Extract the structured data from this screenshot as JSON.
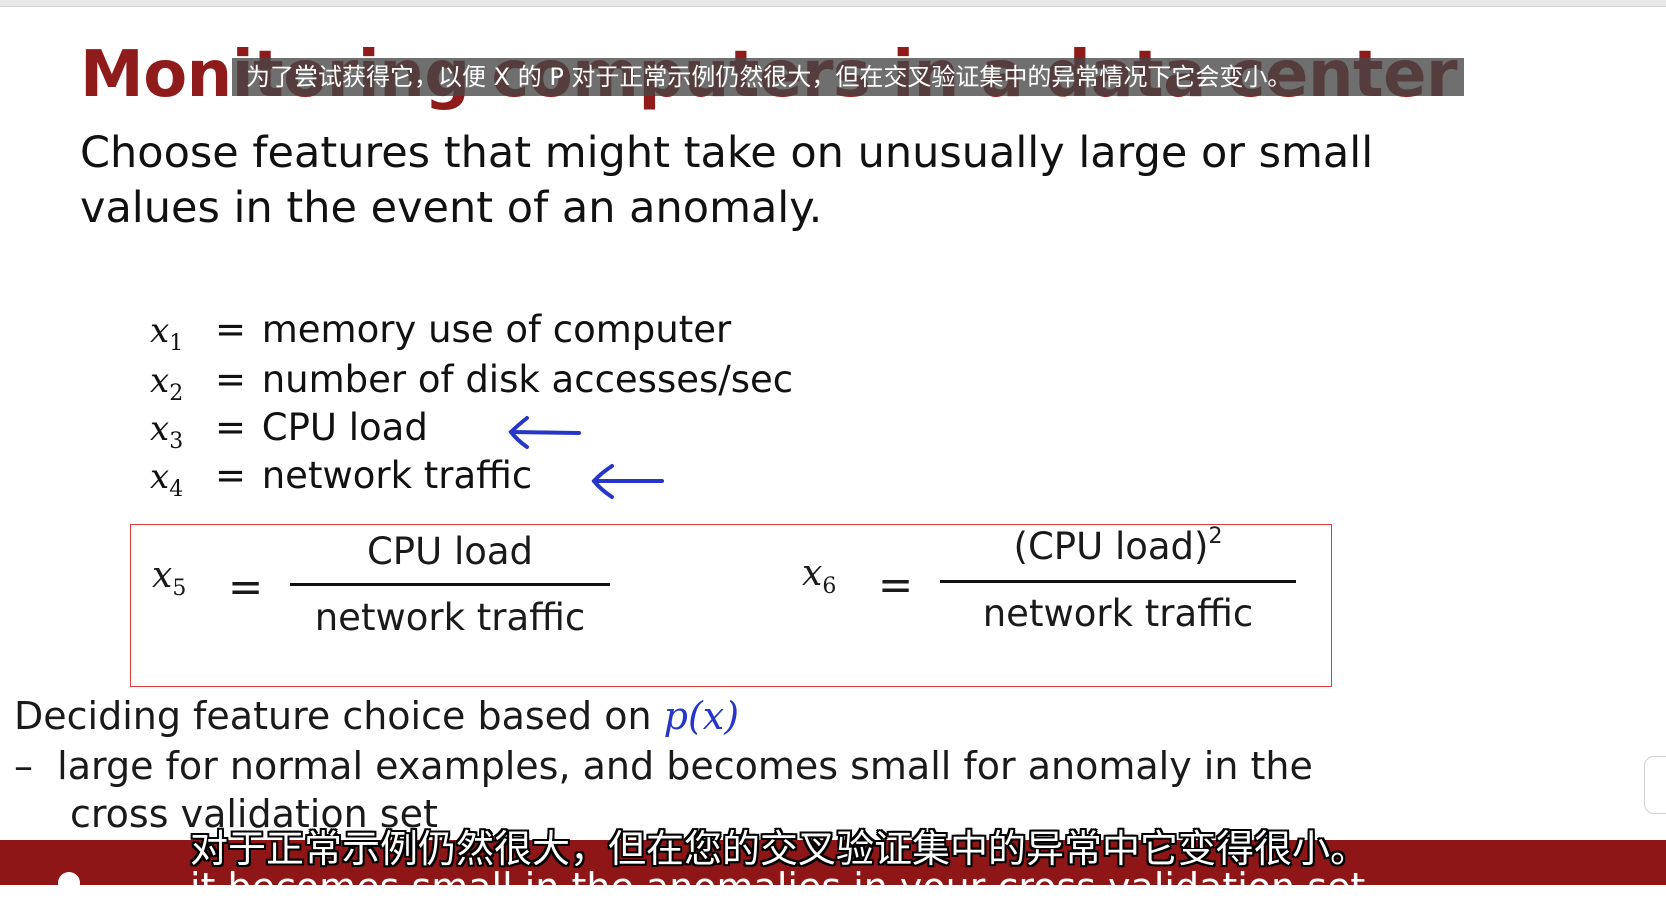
{
  "slide": {
    "title": "Monitoring computers in a data center",
    "intro": "Choose features that might take on unusually large or small values in the event of an anomaly.",
    "features": [
      {
        "var": "x",
        "index": "1",
        "text": "memory use of computer"
      },
      {
        "var": "x",
        "index": "2",
        "text": "number of disk accesses/sec"
      },
      {
        "var": "x",
        "index": "3",
        "text": "CPU load"
      },
      {
        "var": "x",
        "index": "4",
        "text": "network traffic"
      }
    ],
    "equals": "=",
    "engineered": [
      {
        "var": "x",
        "index": "5",
        "numerator": "CPU load",
        "denominator": "network traffic"
      },
      {
        "var": "x",
        "index": "6",
        "numerator": "(CPU load)",
        "numerator_exp": "2",
        "denominator": "network traffic"
      }
    ],
    "decide_text": "Deciding feature choice based on ",
    "decide_math": "p(x)",
    "bullet_dash": "–",
    "bullet_text": "large for normal examples, and becomes small for anomaly in the",
    "bullet_cont": "cross validation set"
  },
  "subtitles": {
    "top_zh": "为了尝试获得它，以便 X 的 P 对于正常示例仍然很大，但在交叉验证集中的异常情况下它会变小。",
    "bottom_zh": "对于正常示例仍然很大，但在您的交叉验证集中的异常中它变得很小。",
    "bottom_en": "it becomes small in the anomalies in your cross validation set"
  },
  "colors": {
    "title": "#8f1b1b",
    "accent_blue": "#2536c8",
    "box_border": "#e03b3b",
    "band": "#8e1616"
  },
  "icons": {
    "arrow": "left-arrow-icon"
  }
}
